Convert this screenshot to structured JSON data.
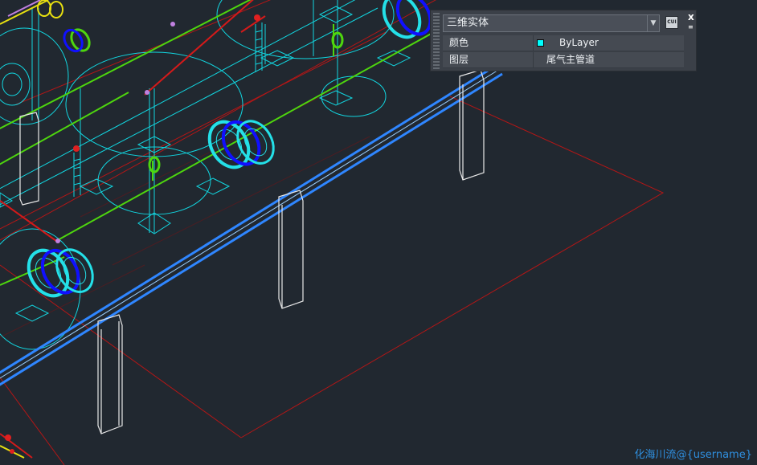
{
  "palette": {
    "object_type": "三维实体",
    "rows": [
      {
        "label": "颜色",
        "value": "ByLayer",
        "swatch_color": "#00ffff"
      },
      {
        "label": "图层",
        "value": "尾气主管道"
      }
    ],
    "cui_label": "CUI",
    "close_glyph": "x",
    "menu_glyph": "≡"
  },
  "watermark": "化海川流@{username}",
  "colors": {
    "background": "#212830",
    "drawing_cyan": "#00e0e8",
    "pipe_blue": "#2f86ff",
    "pipe_green": "#4ed60e",
    "red_lines": "#b01818",
    "white_supports": "#e8e8e8",
    "flange_blue": "#1010ff"
  }
}
